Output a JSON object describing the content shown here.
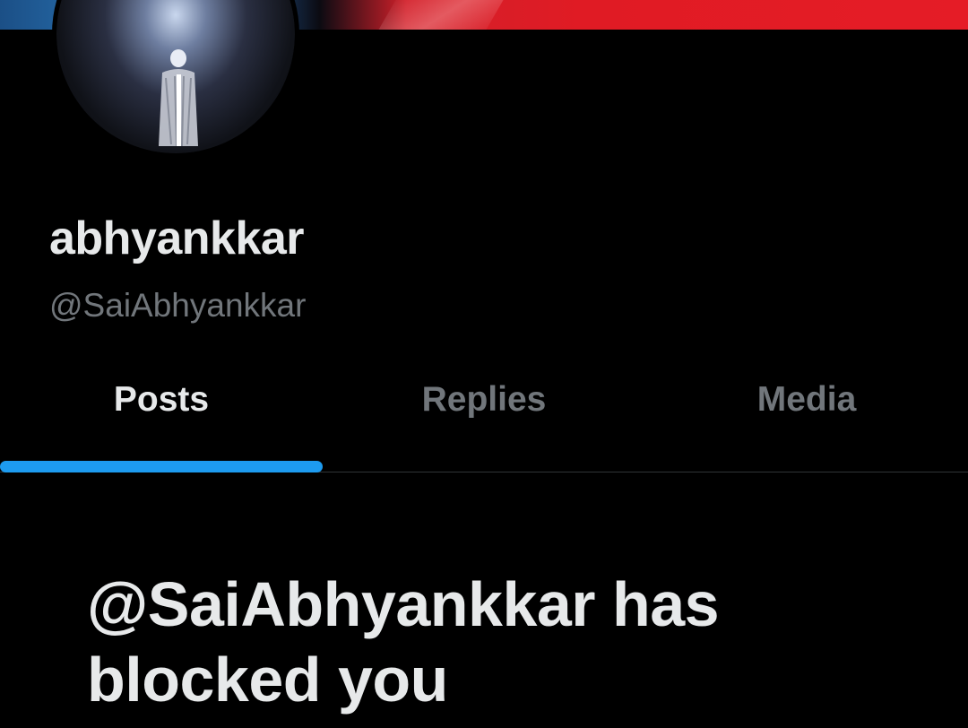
{
  "profile": {
    "name": "abhyankkar",
    "handle": "@SaiAbhyankkar"
  },
  "tabs": [
    {
      "label": "Posts",
      "active": true
    },
    {
      "label": "Replies",
      "active": false
    },
    {
      "label": "Media",
      "active": false
    }
  ],
  "blocked_message": "@SaiAbhyankkar has blocked you",
  "colors": {
    "background": "#000000",
    "primary_text": "#e7e9ea",
    "secondary_text": "#71767b",
    "accent": "#1d9bf0",
    "divider": "#2f3336",
    "banner_red": "#e01b24",
    "banner_blue": "#2f82c6"
  }
}
